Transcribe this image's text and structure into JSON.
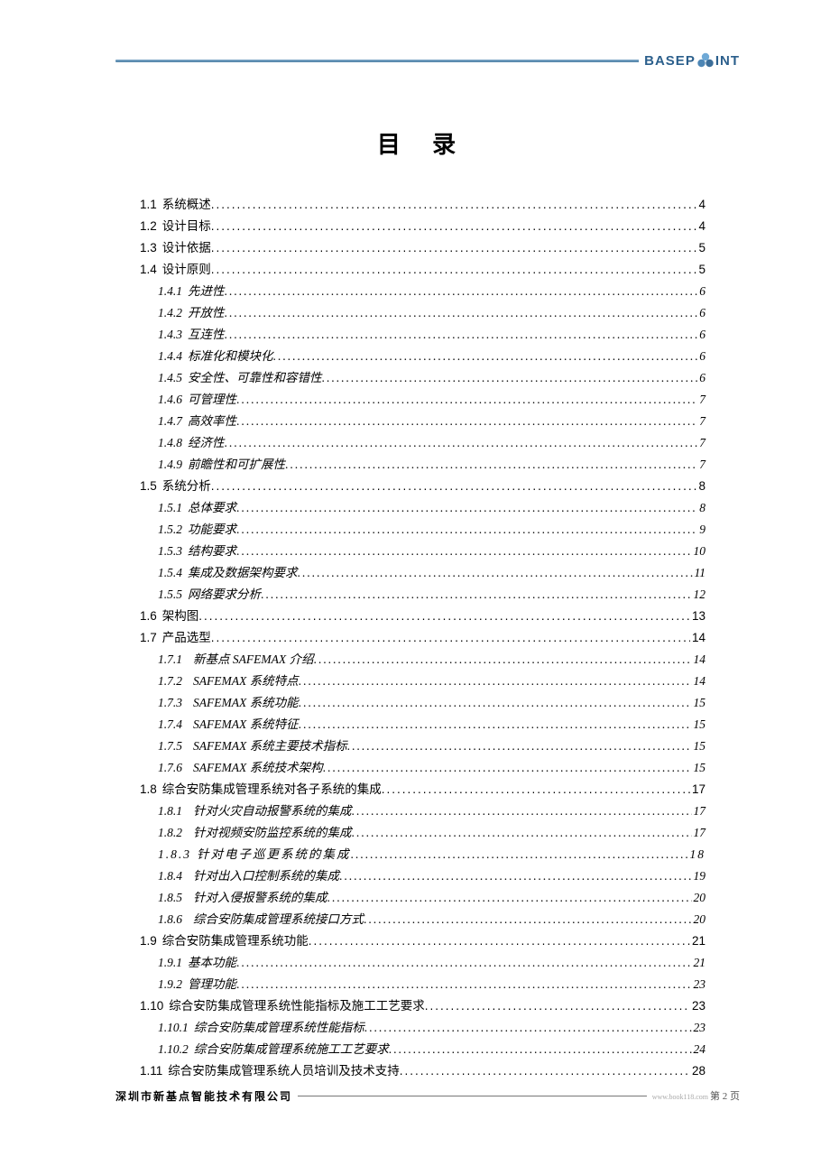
{
  "logo": {
    "left": "BASEP",
    "right": "INT"
  },
  "title": "目 录",
  "toc": [
    {
      "level": 1,
      "num": "1.1",
      "text": "系统概述",
      "page": "4"
    },
    {
      "level": 1,
      "num": "1.2",
      "text": "设计目标",
      "page": "4"
    },
    {
      "level": 1,
      "num": "1.3",
      "text": "设计依据",
      "page": "5"
    },
    {
      "level": 1,
      "num": "1.4",
      "text": "设计原则",
      "page": "5"
    },
    {
      "level": 2,
      "num": "1.4.1",
      "text": "先进性",
      "page": "6"
    },
    {
      "level": 2,
      "num": "1.4.2",
      "text": "开放性",
      "page": "6"
    },
    {
      "level": 2,
      "num": "1.4.3",
      "text": "互连性",
      "page": "6"
    },
    {
      "level": 2,
      "num": "1.4.4",
      "text": "标准化和模块化",
      "page": "6"
    },
    {
      "level": 2,
      "num": "1.4.5",
      "text": "安全性、可靠性和容错性",
      "page": "6"
    },
    {
      "level": 2,
      "num": "1.4.6",
      "text": "可管理性",
      "page": "7"
    },
    {
      "level": 2,
      "num": "1.4.7",
      "text": "高效率性",
      "page": "7"
    },
    {
      "level": 2,
      "num": "1.4.8",
      "text": "经济性",
      "page": "7"
    },
    {
      "level": 2,
      "num": "1.4.9",
      "text": "前瞻性和可扩展性",
      "page": "7"
    },
    {
      "level": 1,
      "num": "1.5",
      "text": "系统分析",
      "page": "8"
    },
    {
      "level": 2,
      "num": "1.5.1",
      "text": "总体要求",
      "page": "8"
    },
    {
      "level": 2,
      "num": "1.5.2",
      "text": "功能要求",
      "page": "9"
    },
    {
      "level": 2,
      "num": "1.5.3",
      "text": "结构要求",
      "page": "10"
    },
    {
      "level": 2,
      "num": "1.5.4",
      "text": "集成及数据架构要求",
      "page": "11"
    },
    {
      "level": 2,
      "num": "1.5.5",
      "text": "网络要求分析",
      "page": "12"
    },
    {
      "level": 1,
      "num": "1.6",
      "text": "架构图",
      "page": "13"
    },
    {
      "level": 1,
      "num": "1.7",
      "text": "产品选型",
      "page": "14"
    },
    {
      "level": 2,
      "num": "1.7.1",
      "text": "新基点 SAFEMAX 介绍",
      "page": "14",
      "wide": true
    },
    {
      "level": 2,
      "num": "1.7.2",
      "text": "SAFEMAX 系统特点",
      "page": "14",
      "wide": true
    },
    {
      "level": 2,
      "num": "1.7.3",
      "text": "SAFEMAX 系统功能",
      "page": "15",
      "wide": true
    },
    {
      "level": 2,
      "num": "1.7.4",
      "text": "SAFEMAX 系统特征",
      "page": "15",
      "wide": true
    },
    {
      "level": 2,
      "num": "1.7.5",
      "text": "SAFEMAX 系统主要技术指标",
      "page": "15",
      "wide": true
    },
    {
      "level": 2,
      "num": "1.7.6",
      "text": "SAFEMAX 系统技术架构",
      "page": "15",
      "wide": true
    },
    {
      "level": 1,
      "num": "1.8",
      "text": "综合安防集成管理系统对各子系统的集成",
      "page": "17"
    },
    {
      "level": 2,
      "num": "1.8.1",
      "text": "针对火灾自动报警系统的集成",
      "page": "17",
      "wide": true
    },
    {
      "level": 2,
      "num": "1.8.2",
      "text": "针对视频安防监控系统的集成",
      "page": "17",
      "wide": true
    },
    {
      "level": 3,
      "num": "1.8.3",
      "text": "针对电子巡更系统的集成",
      "page": "18"
    },
    {
      "level": 2,
      "num": "1.8.4",
      "text": "针对出入口控制系统的集成",
      "page": "19",
      "wide": true
    },
    {
      "level": 2,
      "num": "1.8.5",
      "text": "针对入侵报警系统的集成",
      "page": "20",
      "wide": true
    },
    {
      "level": 2,
      "num": "1.8.6",
      "text": "综合安防集成管理系统接口方式",
      "page": "20",
      "wide": true
    },
    {
      "level": 1,
      "num": "1.9",
      "text": "综合安防集成管理系统功能",
      "page": "21"
    },
    {
      "level": 2,
      "num": "1.9.1",
      "text": "基本功能",
      "page": "21"
    },
    {
      "level": 2,
      "num": "1.9.2",
      "text": "管理功能",
      "page": "23"
    },
    {
      "level": 1,
      "num": "1.10",
      "text": "综合安防集成管理系统性能指标及施工工艺要求",
      "page": "23"
    },
    {
      "level": 2,
      "num": "1.10.1",
      "text": "综合安防集成管理系统性能指标",
      "page": "23"
    },
    {
      "level": 2,
      "num": "1.10.2",
      "text": "综合安防集成管理系统施工工艺要求",
      "page": "24"
    },
    {
      "level": 1,
      "num": "1.11",
      "text": "综合安防集成管理系统人员培训及技术支持",
      "page": "28"
    }
  ],
  "footer": {
    "company": "深圳市新基点智能技术有限公司",
    "url": "www.book118.com",
    "page": "第 2 页"
  }
}
